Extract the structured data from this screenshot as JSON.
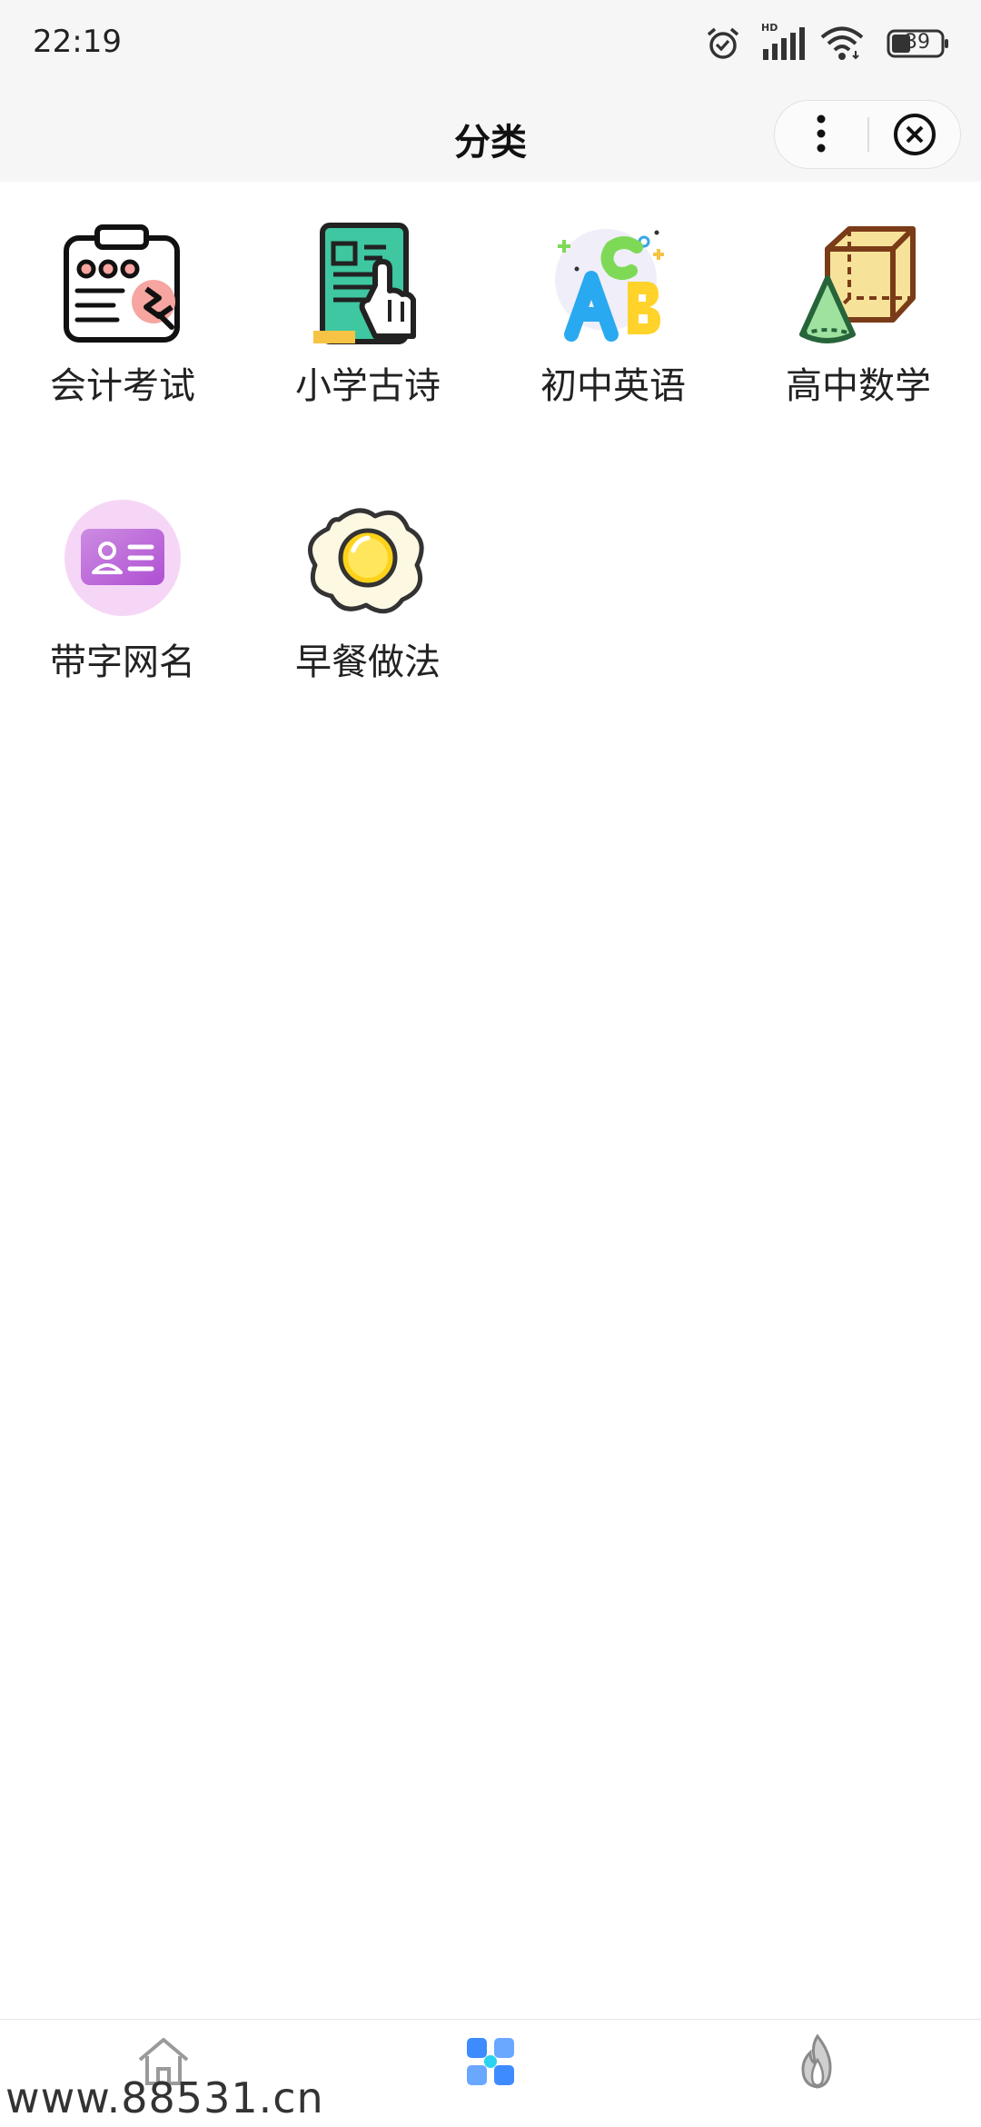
{
  "status_bar": {
    "time": "22:19",
    "battery": "39",
    "network_label": "HD",
    "icons": [
      "alarm-icon",
      "signal-icon",
      "wifi-icon",
      "battery-icon"
    ]
  },
  "nav": {
    "title": "分类"
  },
  "categories": [
    {
      "label": "会计考试",
      "icon": "accounting-clipboard-icon"
    },
    {
      "label": "小学古诗",
      "icon": "tablet-reading-icon"
    },
    {
      "label": "初中英语",
      "icon": "abc-letters-icon"
    },
    {
      "label": "高中数学",
      "icon": "geometry-shapes-icon"
    },
    {
      "label": "带字网名",
      "icon": "id-card-icon"
    },
    {
      "label": "早餐做法",
      "icon": "fried-egg-icon"
    }
  ],
  "tabbar": {
    "tabs": [
      {
        "icon": "home-icon",
        "active": false
      },
      {
        "icon": "category-grid-icon",
        "active": true
      },
      {
        "icon": "flame-icon",
        "active": false
      }
    ],
    "active_color": "#3d8bff"
  },
  "watermark": "www.88531.cn"
}
